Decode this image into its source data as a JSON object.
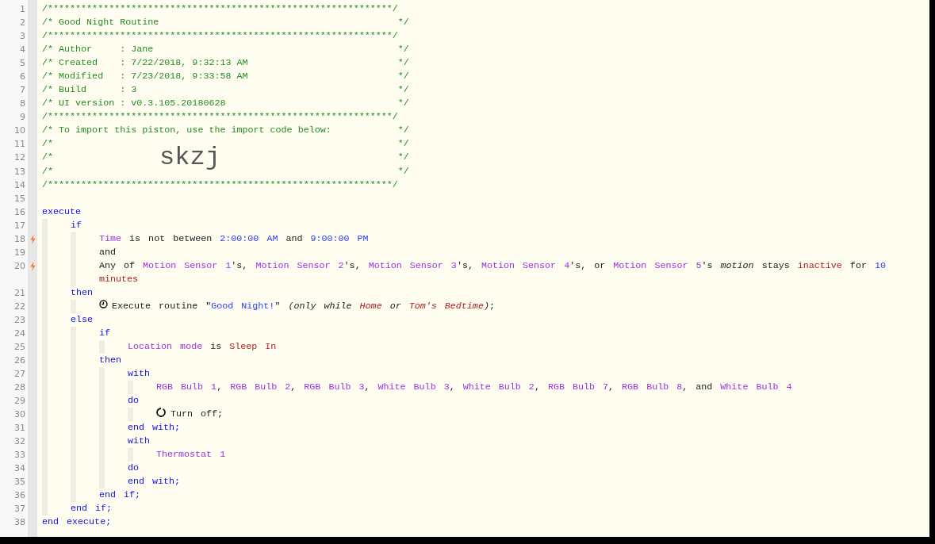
{
  "lines": [
    {
      "number": "1",
      "kind": "rule",
      "trigger": false,
      "text": "/**************************************************************/"
    },
    {
      "number": "2",
      "kind": "box",
      "trigger": false,
      "text": "/* Good Night Routine",
      "end": "*/"
    },
    {
      "number": "3",
      "kind": "rule",
      "trigger": false,
      "text": "/**************************************************************/"
    },
    {
      "number": "4",
      "kind": "box",
      "trigger": false,
      "text": "/* Author     : Jane",
      "end": "*/"
    },
    {
      "number": "5",
      "kind": "box",
      "trigger": false,
      "text": "/* Created    : 7/22/2018, 9:32:13 AM",
      "end": "*/"
    },
    {
      "number": "6",
      "kind": "box",
      "trigger": false,
      "text": "/* Modified   : 7/23/2018, 9:33:58 AM",
      "end": "*/"
    },
    {
      "number": "7",
      "kind": "box",
      "trigger": false,
      "text": "/* Build      : 3",
      "end": "*/"
    },
    {
      "number": "8",
      "kind": "box",
      "trigger": false,
      "text": "/* UI version : v0.3.105.20180628",
      "end": "*/"
    },
    {
      "number": "9",
      "kind": "rule",
      "trigger": false,
      "text": "/**************************************************************/"
    },
    {
      "number": "10",
      "kind": "box",
      "trigger": false,
      "text": "/* To import this piston, use the import code below:",
      "end": "*/"
    },
    {
      "number": "11",
      "kind": "box",
      "trigger": false,
      "text": "/*",
      "end": "*/"
    },
    {
      "number": "12",
      "kind": "box",
      "trigger": false,
      "text": "/*",
      "code": "skzj",
      "end": "*/"
    },
    {
      "number": "13",
      "kind": "box",
      "trigger": false,
      "text": "/*",
      "end": "*/"
    },
    {
      "number": "14",
      "kind": "rule",
      "trigger": false,
      "text": "/**************************************************************/"
    },
    {
      "number": "15",
      "kind": "blank",
      "trigger": false
    },
    {
      "number": "16",
      "kind": "code",
      "trigger": false,
      "tokens": [
        {
          "kind": "keyword",
          "text": "execute"
        }
      ],
      "children": [
        {
          "number": "17",
          "kind": "code",
          "trigger": false,
          "tokens": [
            {
              "kind": "keyword",
              "text": "if"
            }
          ],
          "children": [
            {
              "number": "18",
              "kind": "code",
              "trigger": true,
              "tokens": [
                {
                  "kind": "device",
                  "text": "Time"
                },
                {
                  "kind": "text",
                  "text": " is not between "
                },
                {
                  "kind": "literal",
                  "text": "2:00:00 AM"
                },
                {
                  "kind": "text",
                  "text": " and "
                },
                {
                  "kind": "literal",
                  "text": "9:00:00 PM"
                }
              ]
            },
            {
              "number": "19",
              "kind": "code",
              "trigger": false,
              "tokens": [
                {
                  "kind": "text",
                  "text": "and"
                }
              ]
            },
            {
              "number": "20",
              "kind": "code",
              "trigger": true,
              "tokens": [
                {
                  "kind": "text",
                  "text": "Any of "
                },
                {
                  "kind": "device",
                  "text": "Motion Sensor 1"
                },
                {
                  "kind": "text",
                  "text": "'s, "
                },
                {
                  "kind": "device",
                  "text": "Motion Sensor 2"
                },
                {
                  "kind": "text",
                  "text": "'s, "
                },
                {
                  "kind": "device",
                  "text": "Motion Sensor 3"
                },
                {
                  "kind": "text",
                  "text": "'s, "
                },
                {
                  "kind": "device",
                  "text": "Motion Sensor 4"
                },
                {
                  "kind": "text",
                  "text": "'s, or "
                },
                {
                  "kind": "device",
                  "text": "Motion Sensor 5"
                },
                {
                  "kind": "text",
                  "text": "'s "
                },
                {
                  "kind": "note",
                  "text": "motion"
                },
                {
                  "kind": "text",
                  "text": " stays "
                },
                {
                  "kind": "red",
                  "text": "inactive"
                },
                {
                  "kind": "text",
                  "text": " for "
                },
                {
                  "kind": "literal",
                  "text": "10"
                },
                {
                  "kind": "red",
                  "text": " minutes"
                }
              ]
            }
          ]
        },
        {
          "number": "21",
          "kind": "code",
          "trigger": false,
          "tokens": [
            {
              "kind": "keyword",
              "text": "then"
            }
          ],
          "children": [
            {
              "number": "22",
              "kind": "routine_task",
              "trigger": false,
              "tokens": [
                {
                  "kind": "text",
                  "text": "Execute routine \""
                },
                {
                  "kind": "literal",
                  "text": "Good Night!"
                },
                {
                  "kind": "text",
                  "text": "\" "
                },
                {
                  "kind": "note",
                  "text": "(only while "
                },
                {
                  "kind": "red_note",
                  "text": "Home"
                },
                {
                  "kind": "note",
                  "text": " or "
                },
                {
                  "kind": "red_note",
                  "text": "Tom's Bedtime"
                },
                {
                  "kind": "note",
                  "text": ")"
                },
                {
                  "kind": "text",
                  "text": ";"
                }
              ]
            }
          ]
        },
        {
          "number": "23",
          "kind": "code",
          "trigger": false,
          "tokens": [
            {
              "kind": "keyword",
              "text": "else"
            }
          ],
          "children": [
            {
              "number": "24",
              "kind": "code",
              "trigger": false,
              "tokens": [
                {
                  "kind": "keyword",
                  "text": "if"
                }
              ],
              "children": [
                {
                  "number": "25",
                  "kind": "code",
                  "trigger": false,
                  "tokens": [
                    {
                      "kind": "device",
                      "text": "Location mode"
                    },
                    {
                      "kind": "text",
                      "text": " is "
                    },
                    {
                      "kind": "red",
                      "text": "Sleep In"
                    }
                  ]
                }
              ]
            },
            {
              "number": "26",
              "kind": "code",
              "trigger": false,
              "tokens": [
                {
                  "kind": "keyword",
                  "text": "then"
                }
              ],
              "children": [
                {
                  "number": "27",
                  "kind": "code",
                  "trigger": false,
                  "tokens": [
                    {
                      "kind": "keyword",
                      "text": "with"
                    }
                  ],
                  "children": [
                    {
                      "number": "28",
                      "kind": "code",
                      "trigger": false,
                      "tokens": [
                        {
                          "kind": "device",
                          "text": "RGB Bulb 1"
                        },
                        {
                          "kind": "text",
                          "text": ", "
                        },
                        {
                          "kind": "device",
                          "text": "RGB Bulb 2"
                        },
                        {
                          "kind": "text",
                          "text": ", "
                        },
                        {
                          "kind": "device",
                          "text": "RGB Bulb 3"
                        },
                        {
                          "kind": "text",
                          "text": ", "
                        },
                        {
                          "kind": "device",
                          "text": "White Bulb 3"
                        },
                        {
                          "kind": "text",
                          "text": ", "
                        },
                        {
                          "kind": "device",
                          "text": "White Bulb 2"
                        },
                        {
                          "kind": "text",
                          "text": ", "
                        },
                        {
                          "kind": "device",
                          "text": "RGB Bulb 7"
                        },
                        {
                          "kind": "text",
                          "text": ", "
                        },
                        {
                          "kind": "device",
                          "text": "RGB Bulb 8"
                        },
                        {
                          "kind": "text",
                          "text": ", and "
                        },
                        {
                          "kind": "device",
                          "text": "White Bulb 4"
                        }
                      ]
                    }
                  ]
                },
                {
                  "number": "29",
                  "kind": "code",
                  "trigger": false,
                  "tokens": [
                    {
                      "kind": "keyword",
                      "text": "do"
                    }
                  ],
                  "children": [
                    {
                      "number": "30",
                      "kind": "device_task",
                      "trigger": false,
                      "tokens": [
                        {
                          "kind": "text",
                          "text": "Turn off;"
                        }
                      ]
                    }
                  ]
                },
                {
                  "number": "31",
                  "kind": "code",
                  "trigger": false,
                  "tokens": [
                    {
                      "kind": "keyword",
                      "text": "end with;"
                    }
                  ]
                },
                {
                  "number": "32",
                  "kind": "code",
                  "trigger": false,
                  "tokens": [
                    {
                      "kind": "keyword",
                      "text": "with"
                    }
                  ],
                  "children": [
                    {
                      "number": "33",
                      "kind": "code",
                      "trigger": false,
                      "tokens": [
                        {
                          "kind": "device",
                          "text": "Thermostat 1"
                        }
                      ]
                    }
                  ]
                },
                {
                  "number": "34",
                  "kind": "code",
                  "trigger": false,
                  "tokens": [
                    {
                      "kind": "keyword",
                      "text": "do"
                    }
                  ]
                },
                {
                  "number": "35",
                  "kind": "code",
                  "trigger": false,
                  "tokens": [
                    {
                      "kind": "keyword",
                      "text": "end with;"
                    }
                  ]
                }
              ]
            },
            {
              "number": "36",
              "kind": "code",
              "trigger": false,
              "tokens": [
                {
                  "kind": "keyword",
                  "text": "end if;"
                }
              ]
            }
          ]
        },
        {
          "number": "37",
          "kind": "code",
          "trigger": false,
          "tokens": [
            {
              "kind": "keyword",
              "text": "end if;"
            }
          ]
        }
      ]
    },
    {
      "number": "38",
      "kind": "code",
      "trigger": false,
      "tokens": [
        {
          "kind": "keyword",
          "text": "end execute;"
        }
      ]
    }
  ]
}
